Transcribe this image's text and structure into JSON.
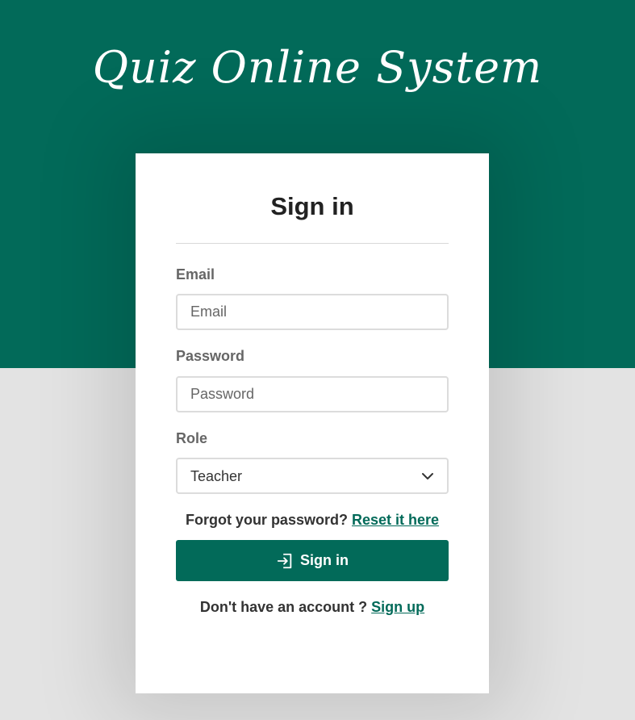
{
  "app_title": "Quiz Online System",
  "colors": {
    "brand": "#026a59",
    "background": "#e3e3e3",
    "card": "#ffffff"
  },
  "form": {
    "title": "Sign in",
    "email": {
      "label": "Email",
      "placeholder": "Email",
      "value": ""
    },
    "password": {
      "label": "Password",
      "placeholder": "Password",
      "value": ""
    },
    "role": {
      "label": "Role",
      "selected": "Teacher",
      "icon": "chevron-down-icon"
    },
    "forgot": {
      "text": "Forgot your password?",
      "link": "Reset it here"
    },
    "submit": {
      "label": "Sign in",
      "icon": "sign-in-icon"
    },
    "signup": {
      "text": "Don't have an account ?",
      "link": "Sign up"
    }
  }
}
